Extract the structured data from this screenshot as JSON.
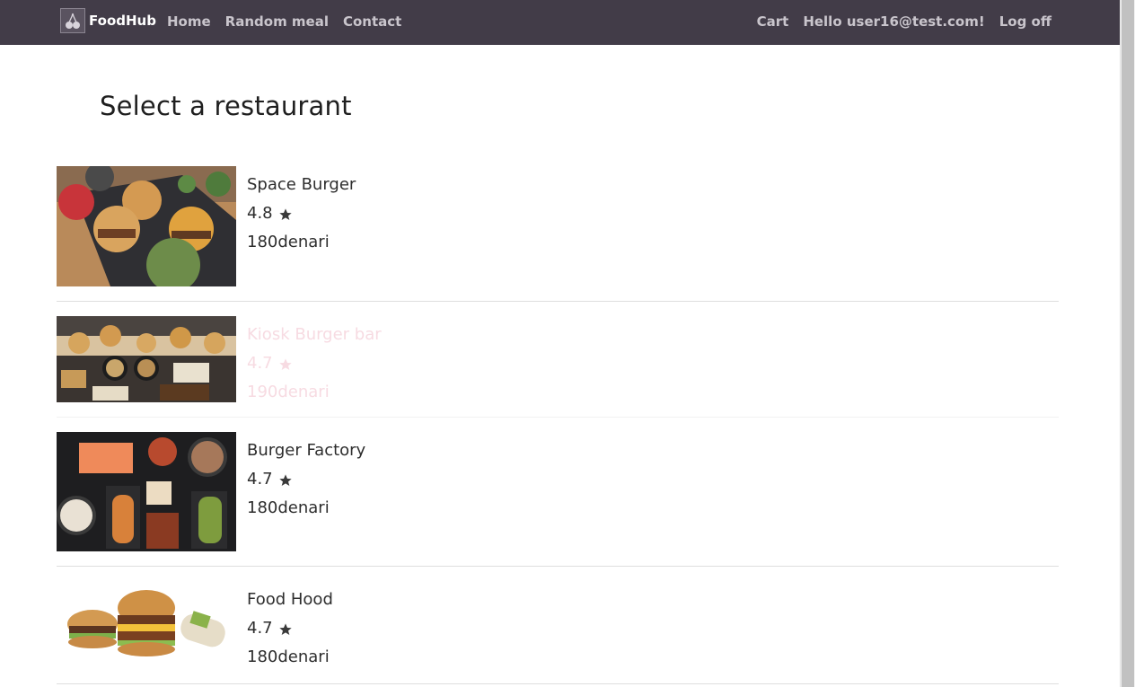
{
  "navbar": {
    "brand": "FoodHub",
    "left_links": [
      "Home",
      "Random meal",
      "Contact"
    ],
    "right_links": {
      "cart": "Cart",
      "greeting": "Hello user16@test.com!",
      "logoff": "Log off"
    }
  },
  "page": {
    "title": "Select a restaurant"
  },
  "restaurants": [
    {
      "name": "Space Burger",
      "rating": "4.8",
      "price": "180denari",
      "image": "burger-sliders"
    },
    {
      "name": "Kiosk Burger bar",
      "rating": "4.7",
      "price": "190denari",
      "image": "burger-spread"
    },
    {
      "name": "Burger Factory",
      "rating": "4.7",
      "price": "180denari",
      "image": "dark-table-spread"
    },
    {
      "name": "Food Hood",
      "rating": "4.7",
      "price": "180denari",
      "image": "burgers-white"
    }
  ],
  "colors": {
    "navbar_bg": "#423c48",
    "nav_link": "#c9c5cc",
    "dim_text": "#f7dbe2"
  },
  "icons": {
    "rating": "star-icon",
    "brand": "cherry-icon"
  }
}
